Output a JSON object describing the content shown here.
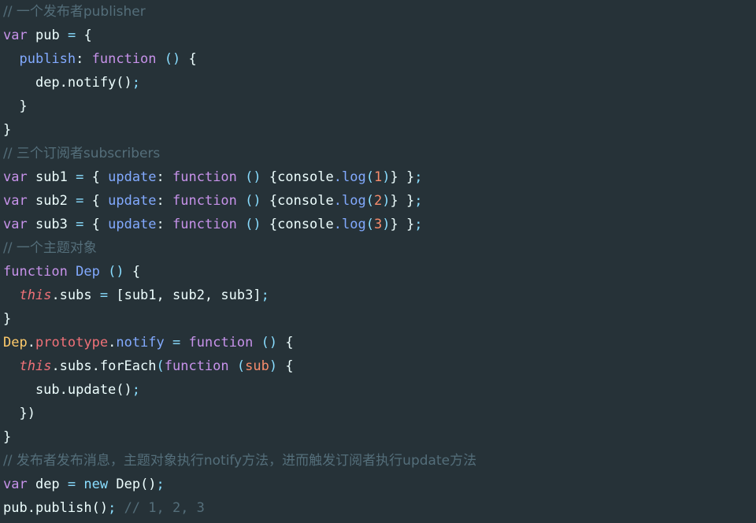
{
  "editor": {
    "background_color": "#263238",
    "font_size_px": 17,
    "line_height_px": 30,
    "language": "javascript"
  },
  "theme": {
    "plain": "#eeffff",
    "comment": "#546e7a",
    "keyword": "#c792ea",
    "function": "#82aaff",
    "punctuation": "#89ddff",
    "number": "#f78c6c",
    "parameter": "#f78c6c",
    "this_keyword": "#f07178",
    "prototype": "#f07178",
    "class_name": "#ffcb6b",
    "operator": "#89ddff"
  },
  "code": {
    "lines": [
      {
        "n": 1,
        "text": "// 一个发布者publisher",
        "tokens": [
          {
            "t": "// 一个发布者publisher",
            "c": "t-comment"
          }
        ]
      },
      {
        "n": 2,
        "text": "var pub = {",
        "tokens": [
          {
            "t": "var",
            "c": "t-keyword"
          },
          {
            "t": " ",
            "c": "t-plain"
          },
          {
            "t": "pub",
            "c": "t-plain"
          },
          {
            "t": " ",
            "c": "t-plain"
          },
          {
            "t": "=",
            "c": "t-operator"
          },
          {
            "t": " ",
            "c": "t-plain"
          },
          {
            "t": "{",
            "c": "t-plain"
          }
        ]
      },
      {
        "n": 3,
        "text": "  publish: function () {",
        "tokens": [
          {
            "t": "  ",
            "c": "t-plain"
          },
          {
            "t": "publish",
            "c": "t-property"
          },
          {
            "t": ":",
            "c": "t-plain"
          },
          {
            "t": " ",
            "c": "t-plain"
          },
          {
            "t": "function",
            "c": "t-keyword"
          },
          {
            "t": " ",
            "c": "t-plain"
          },
          {
            "t": "()",
            "c": "t-punct"
          },
          {
            "t": " ",
            "c": "t-plain"
          },
          {
            "t": "{",
            "c": "t-plain"
          }
        ]
      },
      {
        "n": 4,
        "text": "    dep.notify();",
        "tokens": [
          {
            "t": "    ",
            "c": "t-plain"
          },
          {
            "t": "dep.notify()",
            "c": "t-plain"
          },
          {
            "t": ";",
            "c": "t-punct"
          }
        ]
      },
      {
        "n": 5,
        "text": "  }",
        "tokens": [
          {
            "t": "  }",
            "c": "t-plain"
          }
        ]
      },
      {
        "n": 6,
        "text": "}",
        "tokens": [
          {
            "t": "}",
            "c": "t-plain"
          }
        ]
      },
      {
        "n": 7,
        "text": "// 三个订阅者subscribers",
        "tokens": [
          {
            "t": "// 三个订阅者subscribers",
            "c": "t-comment"
          }
        ]
      },
      {
        "n": 8,
        "text": "var sub1 = { update: function () {console.log(1)} };",
        "tokens": [
          {
            "t": "var",
            "c": "t-keyword"
          },
          {
            "t": " sub1 ",
            "c": "t-plain"
          },
          {
            "t": "=",
            "c": "t-operator"
          },
          {
            "t": " { ",
            "c": "t-plain"
          },
          {
            "t": "update",
            "c": "t-property"
          },
          {
            "t": ": ",
            "c": "t-plain"
          },
          {
            "t": "function",
            "c": "t-keyword"
          },
          {
            "t": " ",
            "c": "t-plain"
          },
          {
            "t": "()",
            "c": "t-punct"
          },
          {
            "t": " {console",
            "c": "t-plain"
          },
          {
            "t": ".log",
            "c": "t-func"
          },
          {
            "t": "(",
            "c": "t-punct"
          },
          {
            "t": "1",
            "c": "t-number"
          },
          {
            "t": ")",
            "c": "t-punct"
          },
          {
            "t": "} }",
            "c": "t-plain"
          },
          {
            "t": ";",
            "c": "t-punct"
          }
        ]
      },
      {
        "n": 9,
        "text": "var sub2 = { update: function () {console.log(2)} };",
        "tokens": [
          {
            "t": "var",
            "c": "t-keyword"
          },
          {
            "t": " sub2 ",
            "c": "t-plain"
          },
          {
            "t": "=",
            "c": "t-operator"
          },
          {
            "t": " { ",
            "c": "t-plain"
          },
          {
            "t": "update",
            "c": "t-property"
          },
          {
            "t": ": ",
            "c": "t-plain"
          },
          {
            "t": "function",
            "c": "t-keyword"
          },
          {
            "t": " ",
            "c": "t-plain"
          },
          {
            "t": "()",
            "c": "t-punct"
          },
          {
            "t": " {console",
            "c": "t-plain"
          },
          {
            "t": ".log",
            "c": "t-func"
          },
          {
            "t": "(",
            "c": "t-punct"
          },
          {
            "t": "2",
            "c": "t-number"
          },
          {
            "t": ")",
            "c": "t-punct"
          },
          {
            "t": "} }",
            "c": "t-plain"
          },
          {
            "t": ";",
            "c": "t-punct"
          }
        ]
      },
      {
        "n": 10,
        "text": "var sub3 = { update: function () {console.log(3)} };",
        "tokens": [
          {
            "t": "var",
            "c": "t-keyword"
          },
          {
            "t": " sub3 ",
            "c": "t-plain"
          },
          {
            "t": "=",
            "c": "t-operator"
          },
          {
            "t": " { ",
            "c": "t-plain"
          },
          {
            "t": "update",
            "c": "t-property"
          },
          {
            "t": ": ",
            "c": "t-plain"
          },
          {
            "t": "function",
            "c": "t-keyword"
          },
          {
            "t": " ",
            "c": "t-plain"
          },
          {
            "t": "()",
            "c": "t-punct"
          },
          {
            "t": " {console",
            "c": "t-plain"
          },
          {
            "t": ".log",
            "c": "t-func"
          },
          {
            "t": "(",
            "c": "t-punct"
          },
          {
            "t": "3",
            "c": "t-number"
          },
          {
            "t": ")",
            "c": "t-punct"
          },
          {
            "t": "} }",
            "c": "t-plain"
          },
          {
            "t": ";",
            "c": "t-punct"
          }
        ]
      },
      {
        "n": 11,
        "text": "// 一个主题对象",
        "tokens": [
          {
            "t": "// 一个主题对象",
            "c": "t-comment"
          }
        ]
      },
      {
        "n": 12,
        "text": "function Dep () {",
        "tokens": [
          {
            "t": "function",
            "c": "t-keyword"
          },
          {
            "t": " ",
            "c": "t-plain"
          },
          {
            "t": "Dep",
            "c": "t-func"
          },
          {
            "t": " ",
            "c": "t-plain"
          },
          {
            "t": "()",
            "c": "t-punct"
          },
          {
            "t": " {",
            "c": "t-plain"
          }
        ]
      },
      {
        "n": 13,
        "text": "  this.subs = [sub1, sub2, sub3];",
        "tokens": [
          {
            "t": "  ",
            "c": "t-plain"
          },
          {
            "t": "this",
            "c": "t-this"
          },
          {
            "t": ".subs ",
            "c": "t-plain"
          },
          {
            "t": "=",
            "c": "t-operator"
          },
          {
            "t": " [sub1, sub2, sub3]",
            "c": "t-plain"
          },
          {
            "t": ";",
            "c": "t-punct"
          }
        ]
      },
      {
        "n": 14,
        "text": "}",
        "tokens": [
          {
            "t": "}",
            "c": "t-plain"
          }
        ]
      },
      {
        "n": 15,
        "text": "Dep.prototype.notify = function () {",
        "tokens": [
          {
            "t": "Dep",
            "c": "t-class"
          },
          {
            "t": ".",
            "c": "t-plain"
          },
          {
            "t": "prototype",
            "c": "t-proto"
          },
          {
            "t": ".",
            "c": "t-plain"
          },
          {
            "t": "notify",
            "c": "t-func"
          },
          {
            "t": " ",
            "c": "t-plain"
          },
          {
            "t": "=",
            "c": "t-operator"
          },
          {
            "t": " ",
            "c": "t-plain"
          },
          {
            "t": "function",
            "c": "t-keyword"
          },
          {
            "t": " ",
            "c": "t-plain"
          },
          {
            "t": "()",
            "c": "t-punct"
          },
          {
            "t": " {",
            "c": "t-plain"
          }
        ]
      },
      {
        "n": 16,
        "text": "  this.subs.forEach(function (sub) {",
        "tokens": [
          {
            "t": "  ",
            "c": "t-plain"
          },
          {
            "t": "this",
            "c": "t-this"
          },
          {
            "t": ".subs.forEach",
            "c": "t-plain"
          },
          {
            "t": "(",
            "c": "t-punct"
          },
          {
            "t": "function",
            "c": "t-keyword"
          },
          {
            "t": " ",
            "c": "t-plain"
          },
          {
            "t": "(",
            "c": "t-punct"
          },
          {
            "t": "sub",
            "c": "t-param"
          },
          {
            "t": ")",
            "c": "t-punct"
          },
          {
            "t": " {",
            "c": "t-plain"
          }
        ]
      },
      {
        "n": 17,
        "text": "    sub.update();",
        "tokens": [
          {
            "t": "    sub.update()",
            "c": "t-plain"
          },
          {
            "t": ";",
            "c": "t-punct"
          }
        ]
      },
      {
        "n": 18,
        "text": "  })",
        "tokens": [
          {
            "t": "  ",
            "c": "t-plain"
          },
          {
            "t": "})",
            "c": "t-plain"
          }
        ]
      },
      {
        "n": 19,
        "text": "}",
        "tokens": [
          {
            "t": "}",
            "c": "t-plain"
          }
        ]
      },
      {
        "n": 20,
        "text": "// 发布者发布消息，主题对象执行notify方法，进而触发订阅者执行update方法",
        "tokens": [
          {
            "t": "// 发布者发布消息，主题对象执行notify方法，进而触发订阅者执行update方法",
            "c": "t-comment"
          }
        ]
      },
      {
        "n": 21,
        "text": "var dep = new Dep();",
        "tokens": [
          {
            "t": "var",
            "c": "t-keyword"
          },
          {
            "t": " dep ",
            "c": "t-plain"
          },
          {
            "t": "=",
            "c": "t-operator"
          },
          {
            "t": " ",
            "c": "t-plain"
          },
          {
            "t": "new",
            "c": "t-punct"
          },
          {
            "t": " Dep()",
            "c": "t-plain"
          },
          {
            "t": ";",
            "c": "t-punct"
          }
        ]
      },
      {
        "n": 22,
        "text": "pub.publish(); // 1, 2, 3",
        "tokens": [
          {
            "t": "pub.publish()",
            "c": "t-plain"
          },
          {
            "t": ";",
            "c": "t-punct"
          },
          {
            "t": " ",
            "c": "t-plain"
          },
          {
            "t": "// 1, 2, 3",
            "c": "t-comment"
          }
        ]
      }
    ]
  }
}
